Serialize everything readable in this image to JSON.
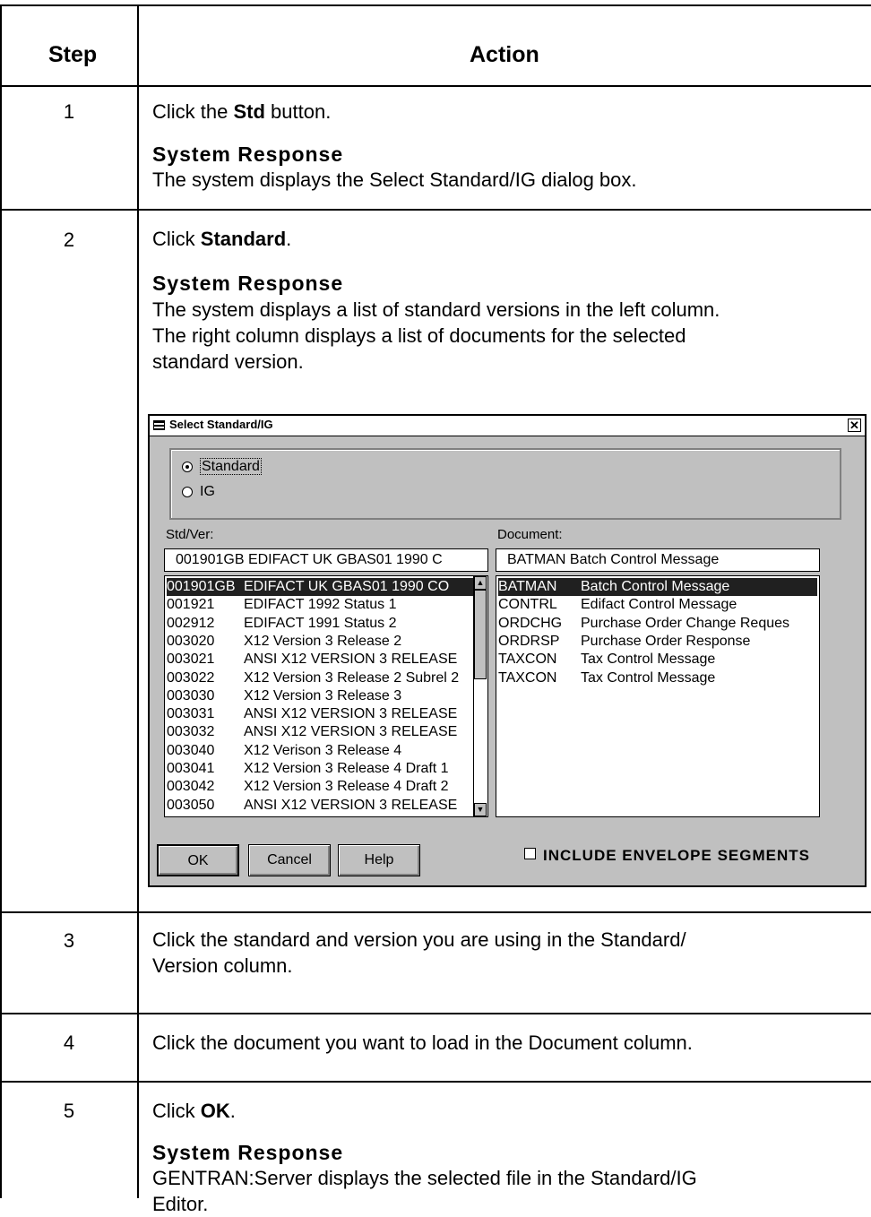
{
  "table": {
    "col_step": "Step",
    "col_action": "Action"
  },
  "steps": [
    {
      "num": "1",
      "pre": "Click the ",
      "bold": "Std",
      "post": " button.",
      "sr_head": "System Response",
      "sr_text": [
        "The system displays the Select Standard/IG dialog box."
      ]
    },
    {
      "num": "2",
      "pre": "Click ",
      "bold": "Standard",
      "post": ".",
      "sr_head": "System Response",
      "sr_text": [
        "The system displays a list of standard versions in the left column.",
        "The right column displays a list of documents for the selected",
        "standard version."
      ]
    },
    {
      "num": "3",
      "text": [
        "Click the standard and version you are using in the Standard/",
        "Version column."
      ]
    },
    {
      "num": "4",
      "text": [
        "Click the document you want to load in the Document column."
      ]
    },
    {
      "num": "5",
      "pre": "Click ",
      "bold": "OK",
      "post": ".",
      "sr_head": "System Response",
      "sr_text": [
        "GENTRAN:Server displays the selected file in the Standard/IG",
        "Editor."
      ]
    }
  ],
  "dialog": {
    "title": "Select Standard/IG",
    "close_glyph": "✕",
    "radio_standard": "Standard",
    "radio_ig": "IG",
    "stdver_label": "Std/Ver:",
    "stdver_value": "001901GB   EDIFACT UK GBAS01 1990 C",
    "document_label": "Document:",
    "document_value": "BATMAN    Batch Control Message",
    "std_list": [
      [
        "001901GB",
        "EDIFACT UK GBAS01 1990 CO"
      ],
      [
        "001921",
        "EDIFACT 1992 Status 1"
      ],
      [
        "002912",
        "EDIFACT 1991 Status 2"
      ],
      [
        "003020",
        "X12 Version 3 Release 2"
      ],
      [
        "003021",
        "ANSI X12 VERSION 3 RELEASE"
      ],
      [
        "003022",
        "X12 Version 3 Release 2 Subrel 2"
      ],
      [
        "003030",
        "X12 Version 3 Release 3"
      ],
      [
        "003031",
        "ANSI X12 VERSION 3 RELEASE"
      ],
      [
        "003032",
        "ANSI X12 VERSION 3 RELEASE"
      ],
      [
        "003040",
        "X12 Verison 3 Release 4"
      ],
      [
        "003041",
        "X12 Version 3 Release 4 Draft 1"
      ],
      [
        "003042",
        "X12 Version 3 Release 4 Draft 2"
      ],
      [
        "003050",
        "ANSI X12 VERSION 3 RELEASE"
      ]
    ],
    "doc_list": [
      [
        "BATMAN",
        "Batch Control Message"
      ],
      [
        "CONTRL",
        "Edifact Control Message"
      ],
      [
        "ORDCHG",
        "Purchase Order Change Reques"
      ],
      [
        "ORDRSP",
        "Purchase Order Response"
      ],
      [
        "TAXCON",
        "Tax Control Message"
      ],
      [
        "TAXCON",
        "Tax Control Message"
      ]
    ],
    "ok_label": "OK",
    "cancel_label": "Cancel",
    "help_label": "Help",
    "include_envelope_label": "INCLUDE ENVELOPE SEGMENTS",
    "scroll_up_glyph": "▲",
    "scroll_down_glyph": "▼"
  }
}
